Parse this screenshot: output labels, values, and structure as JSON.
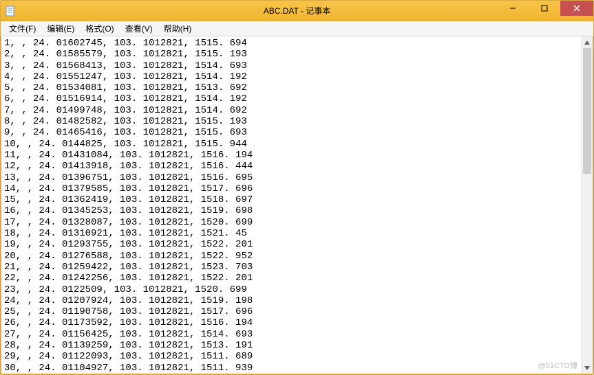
{
  "window": {
    "title": "ABC.DAT - 记事本"
  },
  "menu": {
    "file": "文件(F)",
    "edit": "编辑(E)",
    "format": "格式(O)",
    "view": "查看(V)",
    "help": "帮助(H)"
  },
  "content_lines": [
    "1, , 24. 01602745, 103. 1012821, 1515. 694",
    "2, , 24. 01585579, 103. 1012821, 1515. 193",
    "3, , 24. 01568413, 103. 1012821, 1514. 693",
    "4, , 24. 01551247, 103. 1012821, 1514. 192",
    "5, , 24. 01534081, 103. 1012821, 1513. 692",
    "6, , 24. 01516914, 103. 1012821, 1514. 192",
    "7, , 24. 01499748, 103. 1012821, 1514. 692",
    "8, , 24. 01482582, 103. 1012821, 1515. 193",
    "9, , 24. 01465416, 103. 1012821, 1515. 693",
    "10, , 24. 0144825, 103. 1012821, 1515. 944",
    "11, , 24. 01431084, 103. 1012821, 1516. 194",
    "12, , 24. 01413918, 103. 1012821, 1516. 444",
    "13, , 24. 01396751, 103. 1012821, 1516. 695",
    "14, , 24. 01379585, 103. 1012821, 1517. 696",
    "15, , 24. 01362419, 103. 1012821, 1518. 697",
    "16, , 24. 01345253, 103. 1012821, 1519. 698",
    "17, , 24. 01328087, 103. 1012821, 1520. 699",
    "18, , 24. 01310921, 103. 1012821, 1521. 45",
    "19, , 24. 01293755, 103. 1012821, 1522. 201",
    "20, , 24. 01276588, 103. 1012821, 1522. 952",
    "21, , 24. 01259422, 103. 1012821, 1523. 703",
    "22, , 24. 01242256, 103. 1012821, 1522. 201",
    "23, , 24. 0122509, 103. 1012821, 1520. 699",
    "24, , 24. 01207924, 103. 1012821, 1519. 198",
    "25, , 24. 01190758, 103. 1012821, 1517. 696",
    "26, , 24. 01173592, 103. 1012821, 1516. 194",
    "27, , 24. 01156425, 103. 1012821, 1514. 693",
    "28, , 24. 01139259, 103. 1012821, 1513. 191",
    "29, , 24. 01122093, 103. 1012821, 1511. 689",
    "30, , 24. 01104927, 103. 1012821, 1511. 939"
  ],
  "watermark": "@51CTO博"
}
